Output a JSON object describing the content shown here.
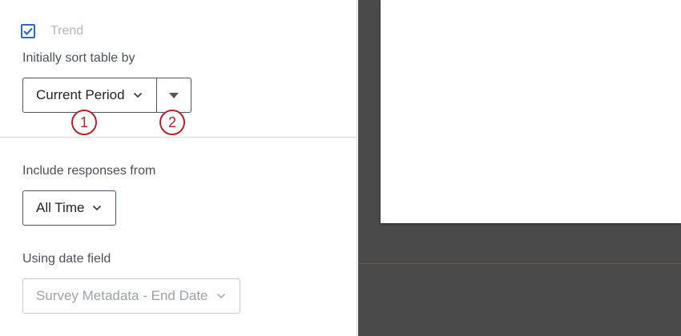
{
  "trend": {
    "label": "Trend",
    "checked": true
  },
  "sort": {
    "label": "Initially sort table by",
    "value": "Current Period",
    "direction_icon": "caret-down-icon"
  },
  "callouts": [
    "1",
    "2"
  ],
  "responses": {
    "label": "Include responses from",
    "value": "All Time"
  },
  "date_field": {
    "label": "Using date field",
    "value": "Survey Metadata - End Date",
    "disabled": true
  },
  "colors": {
    "accent": "#2a6cc2",
    "callout": "#b5222e",
    "preview_background": "#4a4a4a"
  }
}
